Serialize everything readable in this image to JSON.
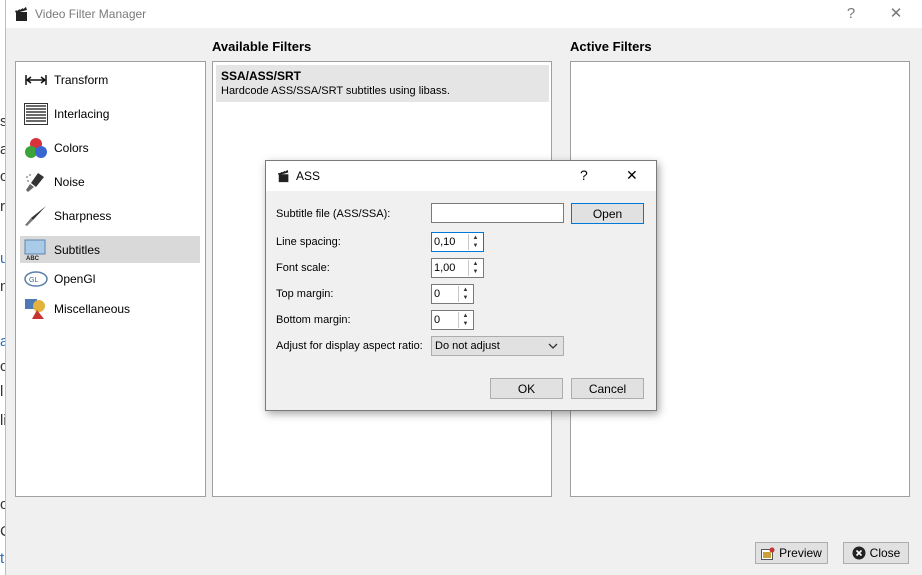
{
  "background": {
    "glyphs": [
      "s",
      "a",
      "c",
      "r",
      "u",
      "n",
      "a",
      "c",
      "l",
      "li",
      "o",
      "C",
      "t"
    ]
  },
  "window": {
    "title": "Video Filter Manager",
    "help_glyph": "?",
    "close_glyph": "✕"
  },
  "sections": {
    "available": "Available Filters",
    "active": "Active Filters"
  },
  "categories": [
    {
      "label": "Transform",
      "icon": "transform-icon"
    },
    {
      "label": "Interlacing",
      "icon": "interlacing-icon"
    },
    {
      "label": "Colors",
      "icon": "colors-icon"
    },
    {
      "label": "Noise",
      "icon": "noise-icon"
    },
    {
      "label": "Sharpness",
      "icon": "sharpness-icon"
    },
    {
      "label": "Subtitles",
      "icon": "subtitles-icon",
      "selected": true
    },
    {
      "label": "OpenGl",
      "icon": "opengl-icon"
    },
    {
      "label": "Miscellaneous",
      "icon": "miscellaneous-icon"
    }
  ],
  "available_filters": [
    {
      "name": "SSA/ASS/SRT",
      "description": "Hardcode ASS/SSA/SRT subtitles using libass."
    }
  ],
  "footer": {
    "preview_label": "Preview",
    "close_label": "Close"
  },
  "dialog": {
    "title": "ASS",
    "help_glyph": "?",
    "close_glyph": "✕",
    "subtitle_file": {
      "label": "Subtitle file (ASS/SSA):",
      "value": "",
      "button": "Open"
    },
    "line_spacing": {
      "label": "Line spacing:",
      "value": "0,10"
    },
    "font_scale": {
      "label": "Font scale:",
      "value": "1,00"
    },
    "top_margin": {
      "label": "Top margin:",
      "value": "0"
    },
    "bottom_margin": {
      "label": "Bottom margin:",
      "value": "0"
    },
    "aspect": {
      "label": "Adjust for display aspect ratio:",
      "value": "Do not adjust"
    },
    "ok_label": "OK",
    "cancel_label": "Cancel"
  },
  "colors": {
    "accent": "#0078d7",
    "selection": "#d9d9d9",
    "window_bg": "#f0f0f0"
  }
}
